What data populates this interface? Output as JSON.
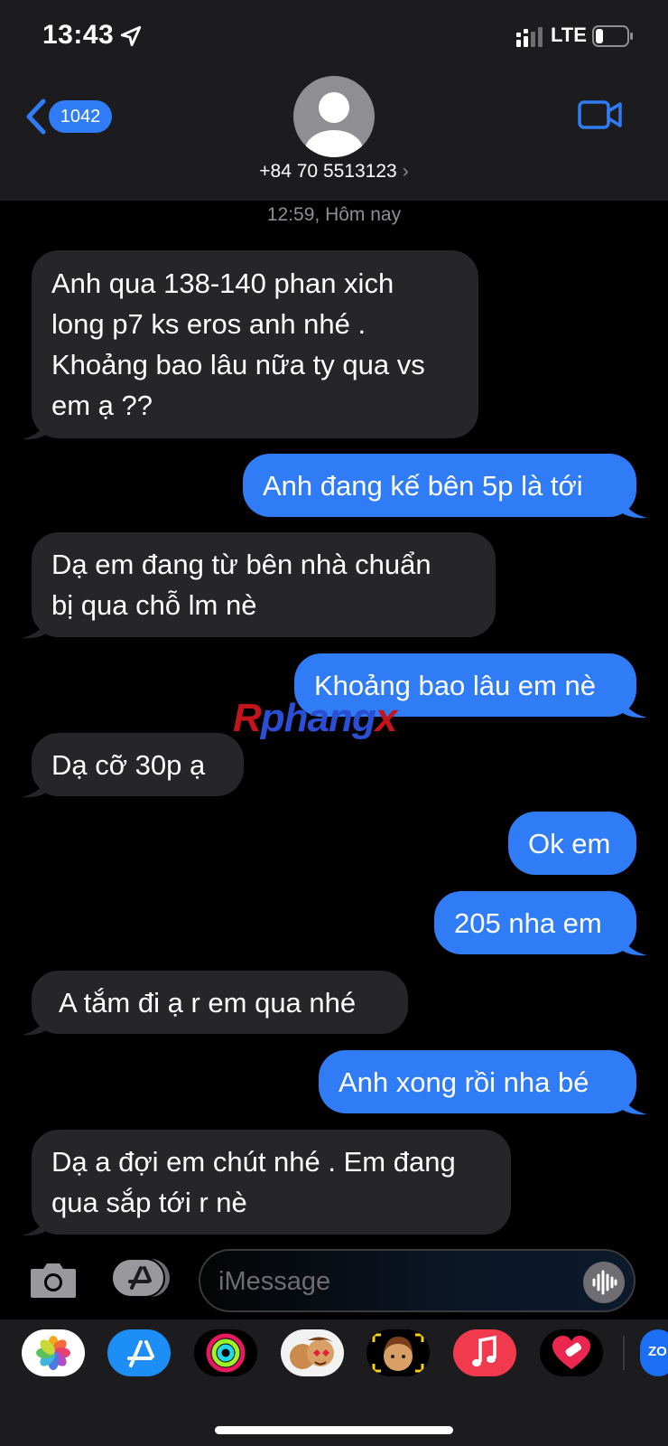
{
  "status_bar": {
    "time": "13:43",
    "network": "LTE"
  },
  "header": {
    "back_count": "1042",
    "contact": "+84 70 5513123",
    "contact_chevron": "›"
  },
  "timestamp": "12:59, Hôm nay",
  "messages": [
    {
      "from": "contact",
      "lines": [
        "Anh qua 138-140 phan xich",
        "long p7 ks eros anh nhé .",
        "Khoảng bao lâu nữa ty qua vs",
        "em ạ ??"
      ]
    },
    {
      "from": "me",
      "lines": [
        "Anh đang kế bên 5p là tới"
      ]
    },
    {
      "from": "contact",
      "lines": [
        "Dạ em đang từ bên  nhà chuẩn",
        "bị qua chỗ lm nè"
      ]
    },
    {
      "from": "me",
      "lines": [
        "Khoảng bao lâu em nè"
      ]
    },
    {
      "from": "contact",
      "lines": [
        "Dạ cỡ 30p ạ"
      ]
    },
    {
      "from": "me",
      "lines": [
        "Ok em"
      ]
    },
    {
      "from": "me",
      "lines": [
        "205 nha em"
      ]
    },
    {
      "from": "contact",
      "lines": [
        "A tắm đi ạ r em qua nhé"
      ]
    },
    {
      "from": "me",
      "lines": [
        "Anh xong rồi nha bé"
      ]
    },
    {
      "from": "contact",
      "lines": [
        "Dạ a đợi em chút nhé . Em đang",
        "qua sắp tới r nè"
      ]
    }
  ],
  "watermark": {
    "part1": "R",
    "part2": "phang",
    "part3": "x"
  },
  "composer": {
    "placeholder": "iMessage"
  },
  "app_drawer": [
    {
      "icon": "photos-icon"
    },
    {
      "icon": "app-store-icon"
    },
    {
      "icon": "fitness-icon"
    },
    {
      "icon": "stickers-icon"
    },
    {
      "icon": "memoji-icon"
    },
    {
      "icon": "music-icon"
    },
    {
      "icon": "heart-sticker-icon"
    },
    {
      "icon": "zalo-icon",
      "label": "ZO"
    }
  ],
  "colors": {
    "accent": "#2f7cf6",
    "incoming_bubble": "#262629",
    "header_bg": "#1c1c1e"
  }
}
